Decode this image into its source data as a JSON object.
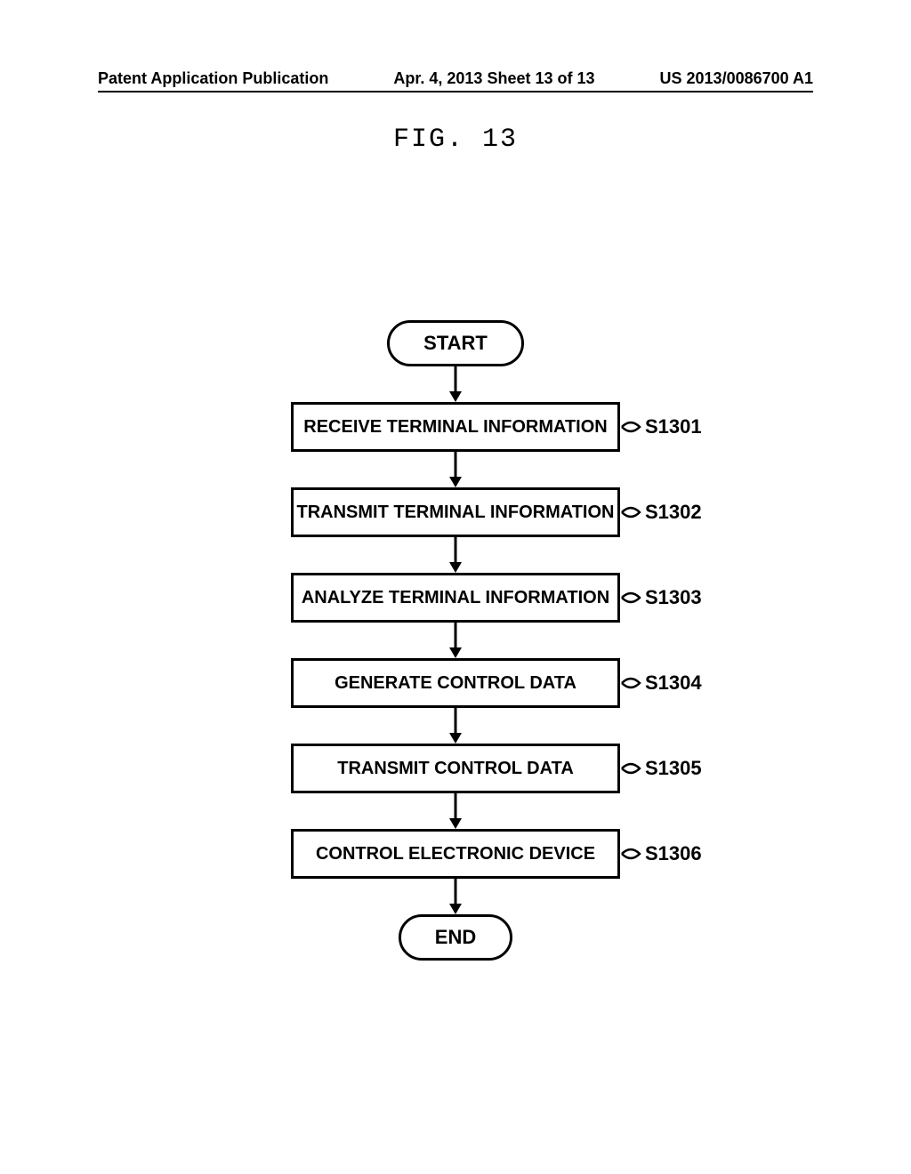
{
  "header": {
    "left": "Patent Application Publication",
    "center": "Apr. 4, 2013  Sheet 13 of 13",
    "right": "US 2013/0086700 A1"
  },
  "figure_label": "FIG. 13",
  "flowchart": {
    "start": "START",
    "end": "END",
    "steps": [
      {
        "text": "RECEIVE TERMINAL INFORMATION",
        "ref": "S1301"
      },
      {
        "text": "TRANSMIT TERMINAL INFORMATION",
        "ref": "S1302"
      },
      {
        "text": "ANALYZE TERMINAL INFORMATION",
        "ref": "S1303"
      },
      {
        "text": "GENERATE CONTROL DATA",
        "ref": "S1304"
      },
      {
        "text": "TRANSMIT CONTROL DATA",
        "ref": "S1305"
      },
      {
        "text": "CONTROL ELECTRONIC DEVICE",
        "ref": "S1306"
      }
    ]
  }
}
